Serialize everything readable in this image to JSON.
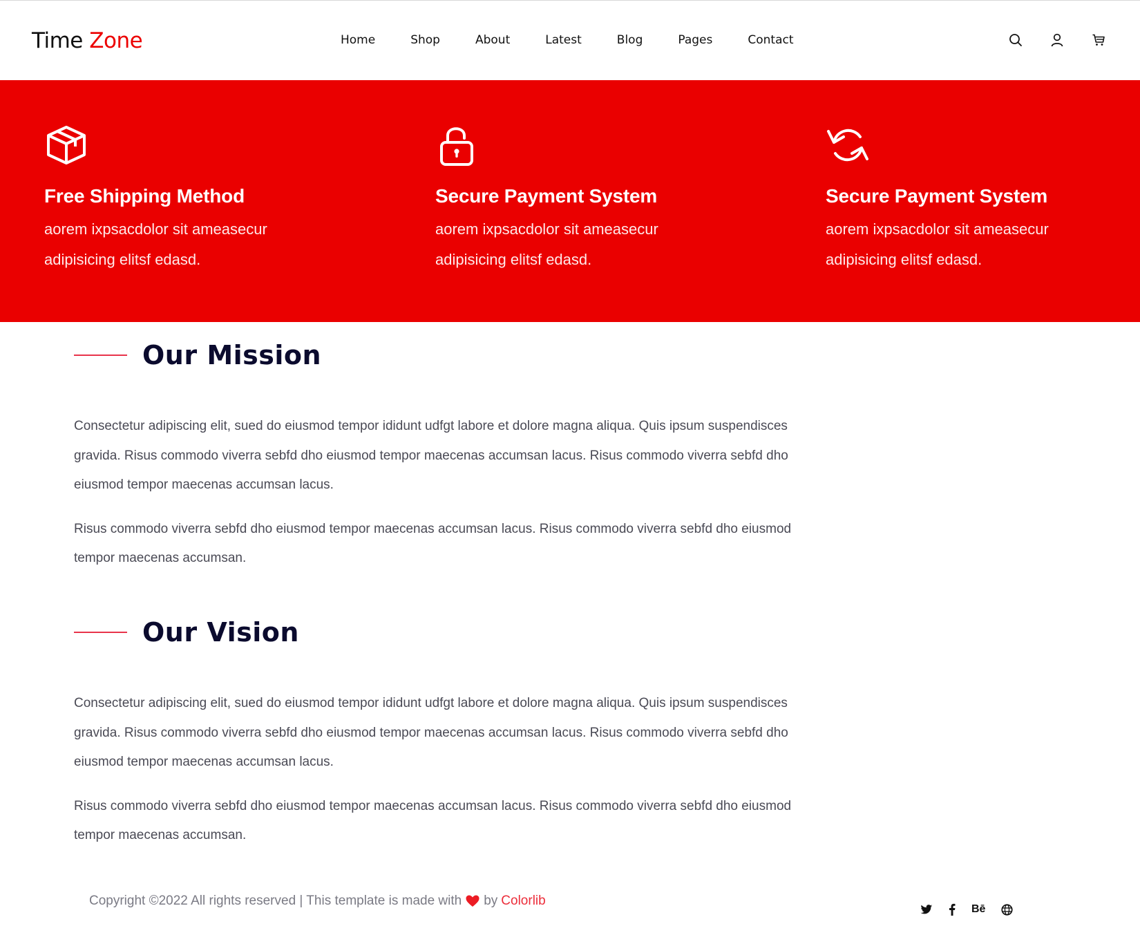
{
  "header": {
    "logo_part1": "Time",
    "logo_part2": "Zone",
    "nav": [
      "Home",
      "Shop",
      "About",
      "Latest",
      "Blog",
      "Pages",
      "Contact"
    ],
    "icons": [
      "search-icon",
      "user-icon",
      "cart-icon"
    ]
  },
  "features": [
    {
      "icon": "box-icon",
      "title": "Free Shipping Method",
      "line1": "aorem ixpsacdolor sit ameasecur",
      "line2": "adipisicing elitsf edasd."
    },
    {
      "icon": "lock-icon",
      "title": "Secure Payment System",
      "line1": "aorem ixpsacdolor sit ameasecur",
      "line2": "adipisicing elitsf edasd."
    },
    {
      "icon": "refresh-icon",
      "title": "Secure Payment System",
      "line1": "aorem ixpsacdolor sit ameasecur",
      "line2": "adipisicing elitsf edasd."
    }
  ],
  "mission": {
    "title": "Our Mission",
    "p1": "Consectetur adipiscing elit, sued do eiusmod tempor ididunt udfgt labore et dolore magna aliqua. Quis ipsum suspendisces gravida. Risus commodo viverra sebfd dho eiusmod tempor maecenas accumsan lacus. Risus commodo viverra sebfd dho eiusmod tempor maecenas accumsan lacus.",
    "p2": "Risus commodo viverra sebfd dho eiusmod tempor maecenas accumsan lacus. Risus commodo viverra sebfd dho eiusmod tempor maecenas accumsan."
  },
  "vision": {
    "title": "Our Vision",
    "p1": "Consectetur adipiscing elit, sued do eiusmod tempor ididunt udfgt labore et dolore magna aliqua. Quis ipsum suspendisces gravida. Risus commodo viverra sebfd dho eiusmod tempor maecenas accumsan lacus. Risus commodo viverra sebfd dho eiusmod tempor maecenas accumsan lacus.",
    "p2": "Risus commodo viverra sebfd dho eiusmod tempor maecenas accumsan lacus. Risus commodo viverra sebfd dho eiusmod tempor maecenas accumsan."
  },
  "footer": {
    "copyright": "Copyright ©2022 All rights reserved | This template is made with",
    "by": "by",
    "brand": "Colorlib",
    "socials": [
      "twitter-icon",
      "facebook-icon",
      "behance-icon",
      "globe-icon"
    ],
    "behance_label": "Bē"
  },
  "colors": {
    "accent": "#ea0000",
    "heading": "#0b0b2e",
    "rule": "#e8334a",
    "body_text": "#4a4a55"
  }
}
